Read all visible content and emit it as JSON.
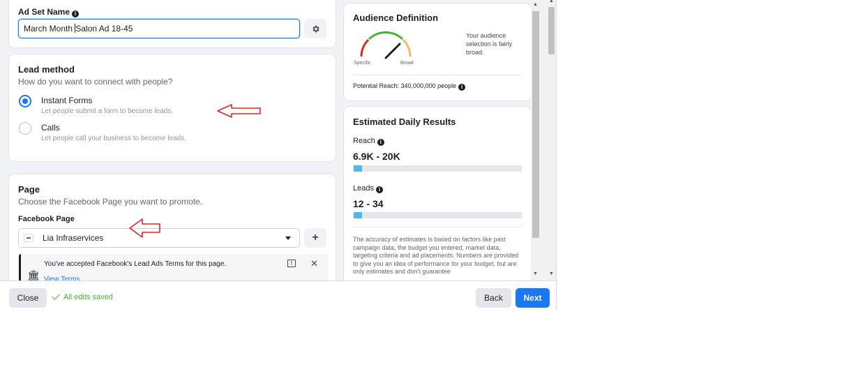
{
  "ad_set": {
    "label": "Ad Set Name",
    "value_before_caret": "March Month ",
    "value_after_caret": "Salon Ad 18-45",
    "settings_icon": "gear-icon"
  },
  "lead_method": {
    "title": "Lead method",
    "subtitle": "How do you want to connect with people?",
    "options": [
      {
        "label": "Instant Forms",
        "description": "Let people submit a form to become leads.",
        "selected": true
      },
      {
        "label": "Calls",
        "description": "Let people call your business to become leads.",
        "selected": false
      }
    ]
  },
  "page": {
    "title": "Page",
    "subtitle": "Choose the Facebook Page you want to promote.",
    "fb_page_label": "Facebook Page",
    "selected_page": "Lia Infraservices",
    "add_icon": "plus-icon",
    "notice": {
      "text": "You've accepted Facebook's Lead Ads Terms for this page.",
      "link": "View Terms"
    }
  },
  "audience": {
    "title": "Audience Definition",
    "gauge_specific": "Specific",
    "gauge_broad": "Broad",
    "description": "Your audience selection is fairly broad.",
    "potential_reach": "Potential Reach: 340,000,000 people"
  },
  "estimates": {
    "title": "Estimated Daily Results",
    "reach_label": "Reach",
    "reach_value": "6.9K - 20K",
    "reach_fill": 0.05,
    "leads_label": "Leads",
    "leads_value": "12 - 34",
    "leads_fill": 0.05,
    "disclaimer": "The accuracy of estimates is based on factors like past campaign data, the budget you entered, market data, targeting criteria and ad placements. Numbers are provided to give you an idea of performance for your budget, but are only estimates and don't guarantee"
  },
  "footer": {
    "close": "Close",
    "saved": "All edits saved",
    "back": "Back",
    "next": "Next"
  },
  "colors": {
    "accent": "#1877f2",
    "saved_green": "#42b72a",
    "annotation_red": "#e02424"
  }
}
